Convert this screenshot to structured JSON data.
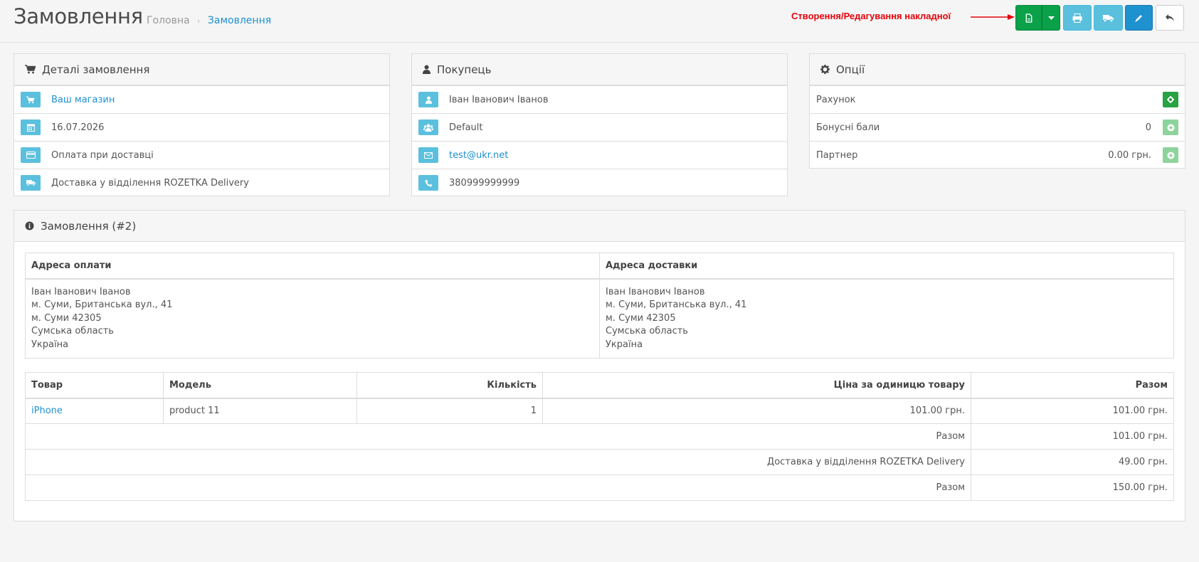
{
  "header": {
    "title": "Замовлення",
    "breadcrumb": [
      "Головна",
      "Замовлення"
    ],
    "annotation": "Створення/Редагування накладної"
  },
  "order_details": {
    "title": "Деталі замовлення",
    "store": "Ваш магазин",
    "date": "16.07.2026",
    "payment": "Оплата при доставці",
    "shipping": "Доставка у відділення ROZETKA Delivery"
  },
  "customer": {
    "title": "Покупець",
    "name": "Іван Іванович Іванов",
    "group": "Default",
    "email": "test@ukr.net",
    "phone": "380999999999"
  },
  "options": {
    "title": "Опції",
    "invoice_label": "Рахунок",
    "reward_label": "Бонусні бали",
    "reward_value": "0",
    "affiliate_label": "Партнер",
    "affiliate_value": "0.00 грн."
  },
  "order": {
    "title": "Замовлення (#2)",
    "payment_address_title": "Адреса оплати",
    "shipping_address_title": "Адреса доставки",
    "payment_address": [
      "Іван Іванович Іванов",
      "м. Суми, Британська вул., 41",
      "м. Суми 42305",
      "Сумська область",
      "Україна"
    ],
    "shipping_address": [
      "Іван Іванович Іванов",
      "м. Суми, Британська вул., 41",
      "м. Суми 42305",
      "Сумська область",
      "Україна"
    ],
    "columns": [
      "Товар",
      "Модель",
      "Кількість",
      "Ціна за одиницю товару",
      "Разом"
    ],
    "products": [
      {
        "name": "iPhone",
        "model": "product 11",
        "quantity": "1",
        "price": "101.00 грн.",
        "total": "101.00 грн."
      }
    ],
    "totals": [
      {
        "title": "Разом",
        "value": "101.00 грн."
      },
      {
        "title": "Доставка у відділення ROZETKA Delivery",
        "value": "49.00 грн."
      },
      {
        "title": "Разом",
        "value": "150.00 грн."
      }
    ]
  },
  "icons": [
    "file-icon",
    "caret-down-icon",
    "print-icon",
    "truck-icon",
    "pencil-icon",
    "reply-icon",
    "cart-icon",
    "calendar-icon",
    "credit-card-icon",
    "user-icon",
    "group-icon",
    "envelope-icon",
    "phone-icon",
    "gear-icon",
    "info-icon",
    "plus-circle-icon"
  ],
  "colors": {
    "accent": "#1e91cf",
    "green": "#0aa149",
    "info": "#5bc0de",
    "annotation": "#e4040a"
  }
}
